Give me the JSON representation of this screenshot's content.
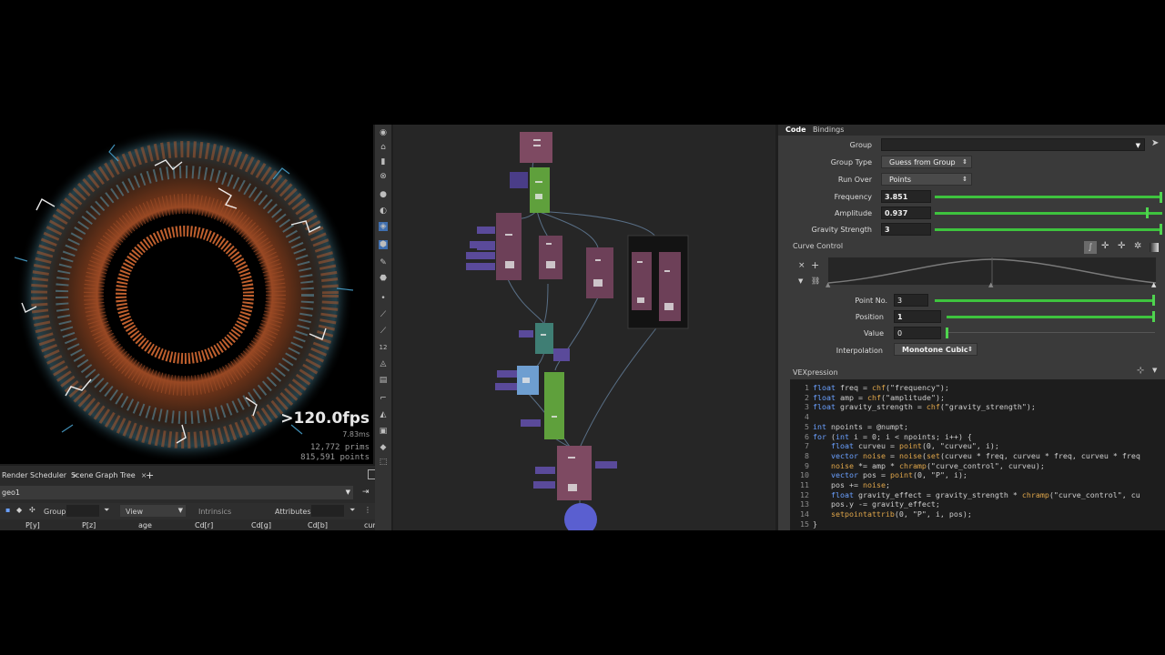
{
  "viewport": {
    "fps": ">120.0fps",
    "ms": "7.83ms",
    "prims_value": "12,772",
    "prims_label": "prims",
    "points_value": "815,591",
    "points_label": "points"
  },
  "spreadsheet": {
    "tabs": [
      "Render Scheduler",
      "Scene Graph Tree"
    ],
    "add_tab": "+",
    "node_path": "geo1",
    "group_label": "Group:",
    "view_label": "View",
    "intrinsics_label": "Intrinsics",
    "attributes_label": "Attributes:",
    "columns": [
      "P[y]",
      "P[z]",
      "age",
      "Cd[r]",
      "Cd[g]",
      "Cd[b]",
      "curvu"
    ]
  },
  "params": {
    "tabs": [
      "Code",
      "Bindings"
    ],
    "group_label": "Group",
    "group_value": "",
    "group_type_label": "Group Type",
    "group_type_value": "Guess from Group",
    "run_over_label": "Run Over",
    "run_over_value": "Points",
    "frequency_label": "Frequency",
    "frequency_value": "3.851",
    "amplitude_label": "Amplitude",
    "amplitude_value": "0.937",
    "gravity_label": "Gravity Strength",
    "gravity_value": "3",
    "curve_control_label": "Curve Control",
    "point_no_label": "Point No.",
    "point_no_value": "3",
    "position_label": "Position",
    "position_value": "1",
    "value_label": "Value",
    "value_value": "0",
    "interpolation_label": "Interpolation",
    "interpolation_value": "Monotone Cubic",
    "vex_label": "VEXpression",
    "frequency_fraction": 1.0,
    "amplitude_fraction": 0.94,
    "gravity_fraction": 1.0,
    "point_no_fraction": 1.0,
    "position_fraction": 1.0,
    "value_fraction": 0.0,
    "slider_color": "#3ec33e"
  },
  "code": {
    "lines": [
      "float freq = chf(\"frequency\");",
      "float amp = chf(\"amplitude\");",
      "float gravity_strength = chf(\"gravity_strength\");",
      "",
      "int npoints = @numpt;",
      "for (int i = 0; i < npoints; i++) {",
      "    float curveu = point(0, \"curveu\", i);",
      "    vector noise = noise(set(curveu * freq, curveu * freq, curveu * freq",
      "    noise *= amp * chramp(\"curve_control\", curveu);",
      "    vector pos = point(0, \"P\", i);",
      "    pos += noise;",
      "    float gravity_effect = gravity_strength * chramp(\"curve_control\", cu",
      "    pos.y -= gravity_effect;",
      "    setpointattrib(0, \"P\", i, pos);",
      "}"
    ]
  }
}
